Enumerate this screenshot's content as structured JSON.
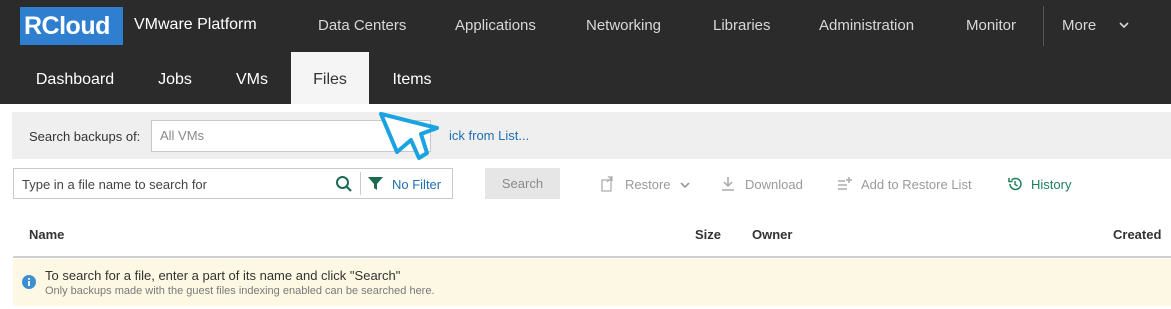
{
  "brand": {
    "logo": "RCloud",
    "platform": "VMware Platform",
    "accent": "#2e7fd0"
  },
  "top_nav": [
    {
      "label": "Data Centers"
    },
    {
      "label": "Applications"
    },
    {
      "label": "Networking"
    },
    {
      "label": "Libraries"
    },
    {
      "label": "Administration"
    },
    {
      "label": "Monitor"
    },
    {
      "label": "More"
    }
  ],
  "sub_nav": [
    {
      "label": "Dashboard",
      "active": false
    },
    {
      "label": "Jobs",
      "active": false
    },
    {
      "label": "VMs",
      "active": false
    },
    {
      "label": "Files",
      "active": true
    },
    {
      "label": "Items",
      "active": false
    }
  ],
  "backup_search": {
    "label": "Search backups of:",
    "vm_value": "All VMs",
    "pick_link": "ick from List..."
  },
  "file_search": {
    "placeholder": "Type in a file name to search for",
    "filter_label": "No Filter",
    "search_button": "Search"
  },
  "toolbar": {
    "restore": "Restore",
    "download": "Download",
    "add_to_restore": "Add to Restore List",
    "history": "History"
  },
  "table": {
    "columns": [
      "Name",
      "Size",
      "Owner",
      "Created"
    ]
  },
  "info": {
    "main": "To search for a file, enter a part of its name and click \"Search\"",
    "sub": "Only backups made with the guest files indexing enabled can be searched here."
  },
  "colors": {
    "topbar": "#2b2b2b",
    "link": "#1f6fb2",
    "history": "#1d7f5a",
    "info_bg": "#fcf8e3",
    "callout": "#1aa3e0"
  }
}
